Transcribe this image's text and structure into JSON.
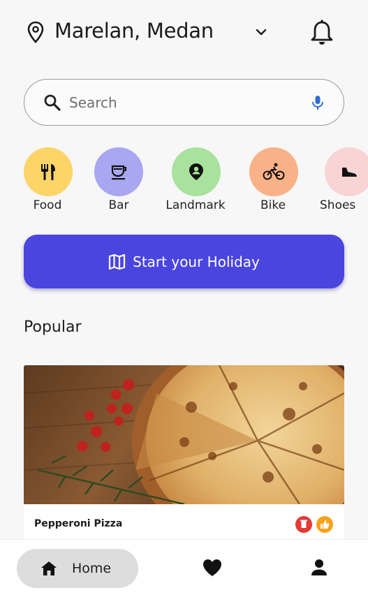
{
  "header": {
    "location": "Marelan, Medan",
    "location_icon": "map-pin-icon",
    "dropdown_icon": "chevron-down-icon",
    "notification_icon": "bell-icon"
  },
  "search": {
    "placeholder": "Search",
    "value": "",
    "search_icon": "magnifier-icon",
    "voice_icon": "microphone-icon"
  },
  "categories": [
    {
      "label": "Food",
      "icon": "cutlery-icon",
      "color": "#fdd468"
    },
    {
      "label": "Bar",
      "icon": "cup-icon",
      "color": "#a9a6f2"
    },
    {
      "label": "Landmark",
      "icon": "person-pin-icon",
      "color": "#a8e29c"
    },
    {
      "label": "Bike",
      "icon": "bicycle-icon",
      "color": "#f9b287"
    },
    {
      "label": "Shoes",
      "icon": "shoe-icon",
      "color": "#f9d4d4"
    }
  ],
  "cta": {
    "label": "Start your Holiday",
    "icon": "map-icon",
    "color": "#4b45e0"
  },
  "popular": {
    "title": "Popular",
    "items": [
      {
        "name": "Pepperoni Pizza",
        "photo": "pizza-photo",
        "badges": [
          "delete-icon",
          "thumbs-up-icon"
        ]
      }
    ]
  },
  "nav": {
    "home_label": "Home",
    "home_icon": "home-icon",
    "favorites_icon": "heart-icon",
    "profile_icon": "person-icon"
  },
  "colors": {
    "accent": "#4b45e0",
    "badge_red": "#e53935",
    "badge_orange": "#f9a11b"
  }
}
